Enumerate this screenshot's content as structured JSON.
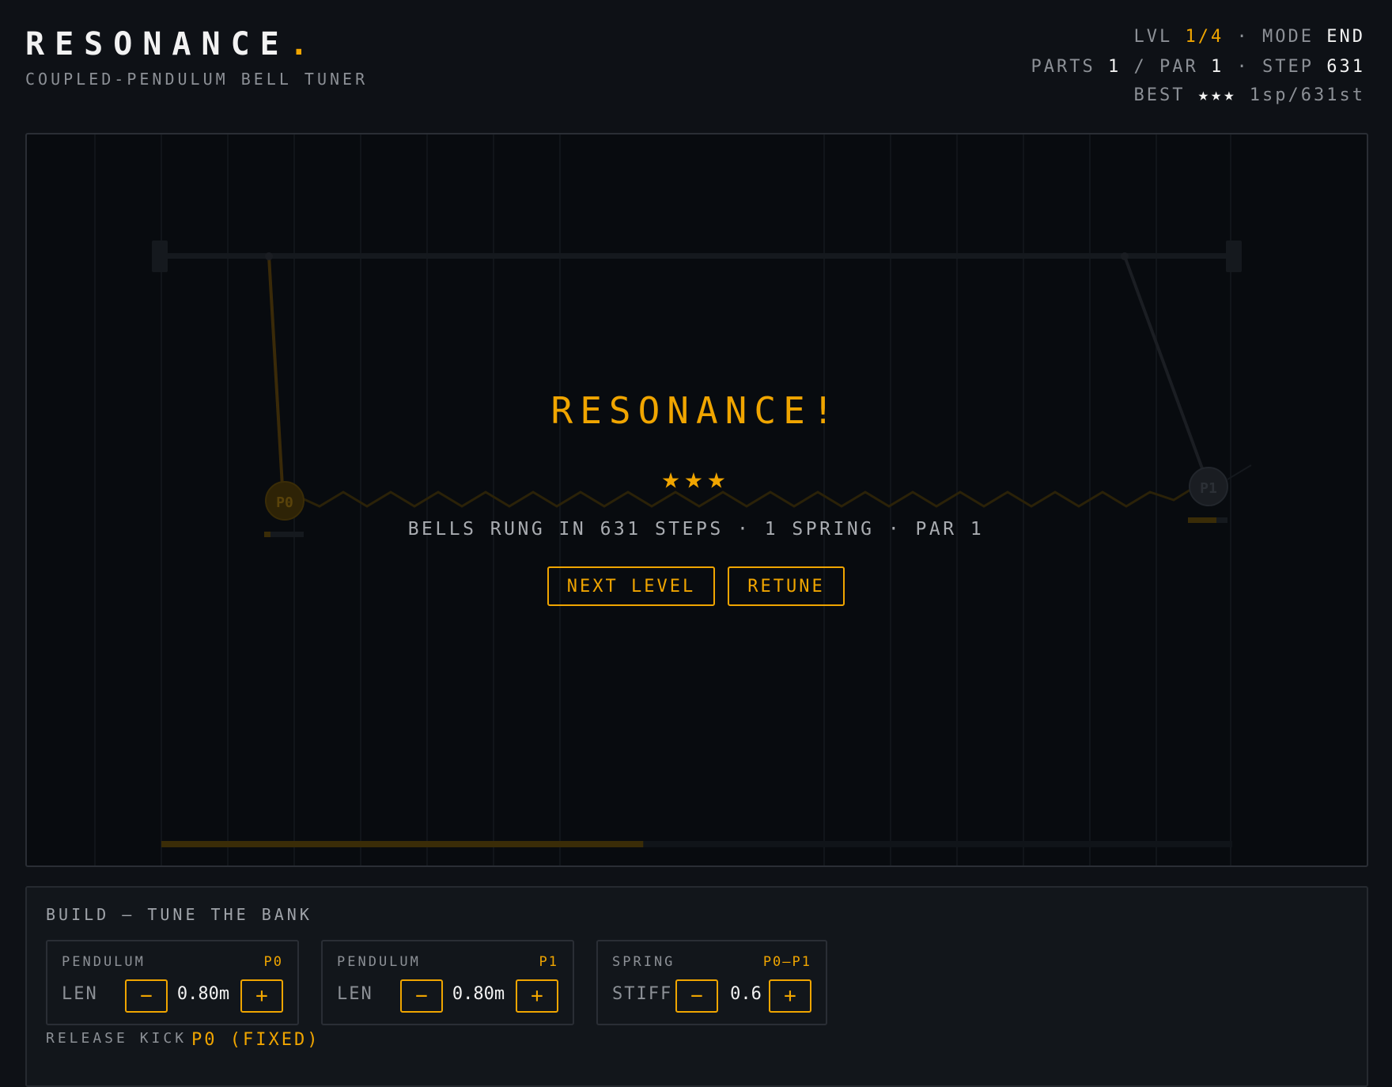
{
  "header": {
    "title": "RESONANCE",
    "title_dot": ".",
    "subtitle": "COUPLED-PENDULUM BELL TUNER",
    "level_label": "LVL",
    "level_value": "1/4",
    "mode_label": "· MODE",
    "mode_value": "END",
    "parts_label": "PARTS",
    "parts_value": "1",
    "par_label": "/ PAR",
    "par_value": "1",
    "step_label": "· STEP",
    "step_value": "631",
    "best_label": "BEST",
    "best_stars": "★★★",
    "best_value": "1sp/631st"
  },
  "stage": {
    "pendulum_labels": [
      "P0",
      "P1"
    ],
    "progress_fraction": 0.45
  },
  "overlay": {
    "title": "RESONANCE!",
    "stars": "★★★",
    "summary": "BELLS RUNG IN 631 STEPS · 1 SPRING · PAR 1",
    "next_label": "NEXT LEVEL",
    "retune_label": "RETUNE"
  },
  "build": {
    "label": "BUILD — TUNE THE BANK",
    "cards": [
      {
        "type": "PENDULUM",
        "tag": "P0",
        "param": "LEN",
        "value": "0.80m",
        "minus": "−",
        "plus": "+"
      },
      {
        "type": "PENDULUM",
        "tag": "P1",
        "param": "LEN",
        "value": "0.80m",
        "minus": "−",
        "plus": "+"
      },
      {
        "type": "SPRING",
        "tag": "P0–P1",
        "param": "STIFF",
        "value": "0.6",
        "minus": "−",
        "plus": "+"
      }
    ],
    "kick_label": "RELEASE KICK",
    "kick_value": "P0 (FIXED)"
  },
  "colors": {
    "accent": "#f0a500",
    "background": "#0e1116",
    "stage_bg": "#080b0f"
  }
}
